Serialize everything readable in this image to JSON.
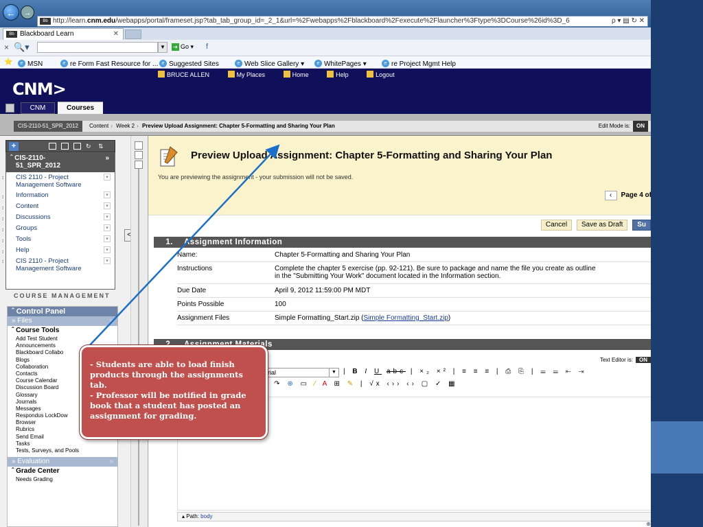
{
  "browser": {
    "url_prefix": "http://learn.",
    "url_host": "cnm.edu",
    "url_rest": "/webapps/portal/frameset.jsp?tab_tab_group_id=_2_1&url=%2Fwebapps%2Fblackboard%2Fexecute%2Flauncher%3Ftype%3DCourse%26id%3D_6",
    "url_icons": "ρ ▾ ▤ ↻ ✕",
    "tab_title": "Blackboard Learn",
    "tab_close": "✕",
    "toolbar_go": "Go",
    "favorites": [
      "MSN",
      "re Form Fast Resource for ...",
      "Suggested Sites",
      "Web Slice Gallery ▾",
      "WhitePages ▾",
      "re Project Mgmt Help"
    ]
  },
  "bb": {
    "logo": "CNM>",
    "user": "BRUCE ALLEN",
    "top_links": [
      "My Places",
      "Home",
      "Help",
      "Logout"
    ],
    "tabs": {
      "cnm": "CNM",
      "courses": "Courses"
    }
  },
  "breadcrumb": {
    "course_id": "CIS-2110-51_SPR_2012",
    "items": [
      "Content",
      "Week 2"
    ],
    "current": "Preview Upload Assignment: Chapter 5-Formatting and Sharing Your Plan",
    "edit_mode_label": "Edit Mode is:",
    "edit_mode_value": "ON"
  },
  "course_menu": {
    "header_line1": "CIS-2110-",
    "header_line2": "51_SPR_2012",
    "items": [
      {
        "label1": "CIS 2110 - Project",
        "label2": "Management Software"
      },
      {
        "label1": "Information"
      },
      {
        "label1": "Content"
      },
      {
        "label1": "Discussions"
      },
      {
        "label1": "Groups"
      },
      {
        "label1": "Tools"
      },
      {
        "label1": "Help"
      },
      {
        "label1": "CIS 2110 - Project",
        "label2": "Management Software"
      }
    ]
  },
  "course_management": {
    "title": "COURSE MANAGEMENT",
    "control_panel": "Control Panel",
    "files": "Files",
    "course_tools": "Course Tools",
    "tools": [
      "Add Test Student",
      "Announcements",
      "Blackboard Collabo",
      "Blogs",
      "Collaboration",
      "Contacts",
      "Course Calendar",
      "Discussion Board",
      "Glossary",
      "Journals",
      "Messages",
      "Respondus LockDow",
      "Browser",
      "Rubrics",
      "Send Email",
      "Tasks",
      "Tests, Surveys, and Pools"
    ],
    "evaluation": "Evaluation",
    "grade_center": "Grade Center",
    "needs_grading": "Needs Grading"
  },
  "page": {
    "title": "Preview Upload Assignment: Chapter 5-Formatting and Sharing Your Plan",
    "note": "You are previewing the assignment - your submission will not be saved.",
    "pager": "Page 4 of",
    "actions": {
      "cancel": "Cancel",
      "draft": "Save as Draft",
      "submit": "Su"
    }
  },
  "section1": {
    "number": "1.",
    "title": "Assignment Information",
    "rows": [
      {
        "key": "Name:",
        "value": "Chapter 5-Formatting and Sharing Your Plan"
      },
      {
        "key": "Instructions",
        "value": "Complete the chapter 5 exercise (pp. 92-121). Be sure to package and name the file you create as outline",
        "value2": "in the \"Submitting Your Work\" document located in the Information section."
      },
      {
        "key": "Due Date",
        "value": "April 9, 2012 11:59:00 PM MDT"
      },
      {
        "key": "Points Possible",
        "value": "100"
      },
      {
        "key": "Assignment Files",
        "value": "Simple Formatting_Start.zip (",
        "link": "Simple Formatting_Start.zip",
        "value_end": ")"
      }
    ]
  },
  "section2": {
    "number": "2.",
    "title": "Assignment Materials",
    "editor_label": "Text Editor is:",
    "editor_value": "ON",
    "font": "Arial",
    "path_label": "Path:",
    "path_value": "body"
  },
  "callout": {
    "line1": "-  Students are able to load finish products through the assignments tab.",
    "line2": "-  Professor will be notified in grade book that a student has posted an assignment for grading."
  }
}
